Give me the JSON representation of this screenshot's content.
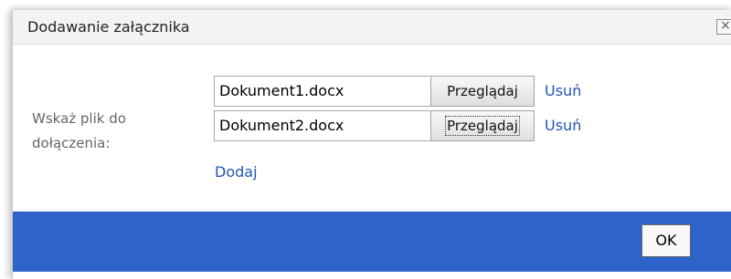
{
  "dialog": {
    "title": "Dodawanie załącznika",
    "close_icon": "close-icon",
    "close_glyph": "×"
  },
  "form": {
    "label": "Wskaż plik do dołączenia:",
    "files": [
      {
        "value": "Dokument1.docx",
        "browse_label": "Przeglądaj",
        "remove_label": "Usuń"
      },
      {
        "value": "Dokument2.docx",
        "browse_label": "Przeglądaj",
        "remove_label": "Usuń"
      }
    ],
    "add_label": "Dodaj"
  },
  "footer": {
    "ok_label": "OK",
    "color": "#2e63c9"
  }
}
